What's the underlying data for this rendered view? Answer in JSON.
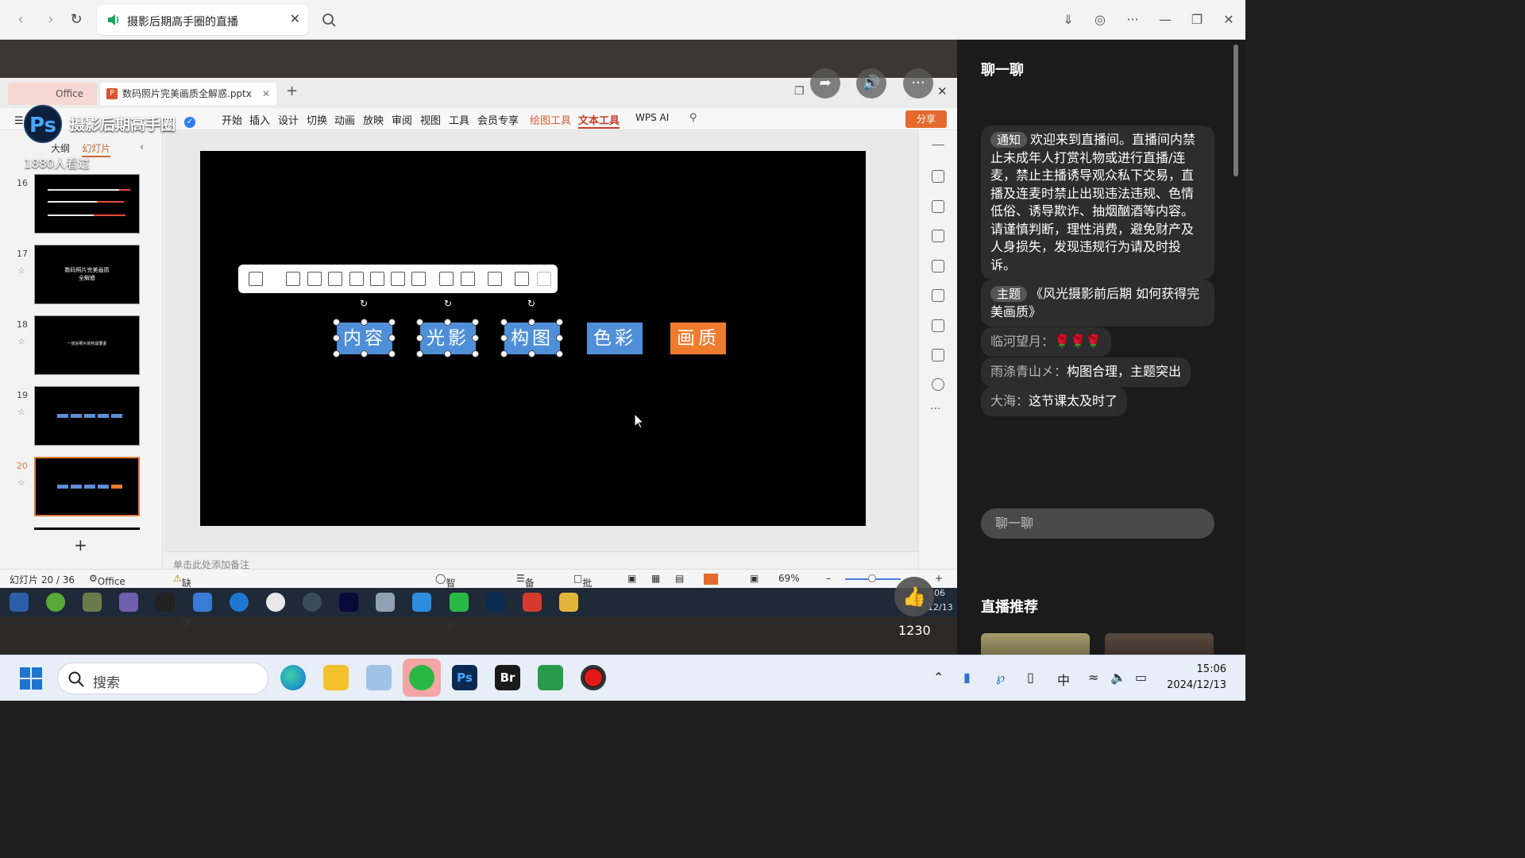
{
  "browser": {
    "tab_title": "摄影后期高手圈的直播"
  },
  "streamer": {
    "name": "摄影后期高手圈",
    "avatar_text": "Ps",
    "viewers": "1880人看过"
  },
  "wps": {
    "home_tab": "Office",
    "file_tab": "数码照片完美画质全解惑.pptx",
    "menu": [
      "开始",
      "插入",
      "设计",
      "切换",
      "动画",
      "放映",
      "审阅",
      "视图",
      "工具",
      "会员专享"
    ],
    "menu_file": "文件",
    "drawing_tools": "绘图工具",
    "text_tools": "文本工具",
    "wps_ai": "WPS AI",
    "share": "分享",
    "panel_tabs": [
      "大纲",
      "幻灯片"
    ],
    "slide_numbers": [
      "16",
      "17",
      "18",
      "19",
      "20"
    ],
    "thumb17_text": "数码照片完美画质\n全解惑",
    "thumb18_text": "一张好照片的构成要素",
    "slide_boxes": [
      "内容",
      "光影",
      "构图",
      "色彩",
      "画质"
    ],
    "notes_placeholder": "单击此处添加备注",
    "status": {
      "slide_counter": "幻灯片 20 / 36",
      "theme": "Office 主题",
      "missing_font": "缺失字体",
      "smart": "智能美化",
      "notes": "备注",
      "comments": "批注",
      "zoom": "69%"
    },
    "inner_clock_time": "06",
    "inner_clock_date": "12/13"
  },
  "like_count": "1230",
  "chat": {
    "title": "聊一聊",
    "notice_tag": "通知",
    "notice_text": "欢迎来到直播间。直播间内禁止未成年人打赏礼物或进行直播/连麦，禁止主播诱导观众私下交易，直播及连麦时禁止出现违法违规、色情低俗、诱导欺诈、抽烟酗酒等内容。请谨慎判断，理性消费，避免财产及人身损失，发现违规行为请及时投诉。",
    "topic_tag": "主题",
    "topic_text": "《风光摄影前后期 如何获得完美画质》",
    "messages": [
      {
        "user": "临河望月：",
        "text": "🌹🌹🌹"
      },
      {
        "user": "雨涤青山㐅：",
        "text": "构图合理，主题突出"
      },
      {
        "user": "大海：",
        "text": "这节课太及时了"
      }
    ],
    "input_placeholder": "聊一聊",
    "recommend_title": "直播推荐"
  },
  "taskbar": {
    "search_placeholder": "搜索",
    "ime": "中",
    "time": "15:06",
    "date": "2024/12/13"
  },
  "colors": {
    "accent_orange": "#ef7b2e",
    "box_blue": "#4f8fd8",
    "wps_red": "#c4402c"
  }
}
